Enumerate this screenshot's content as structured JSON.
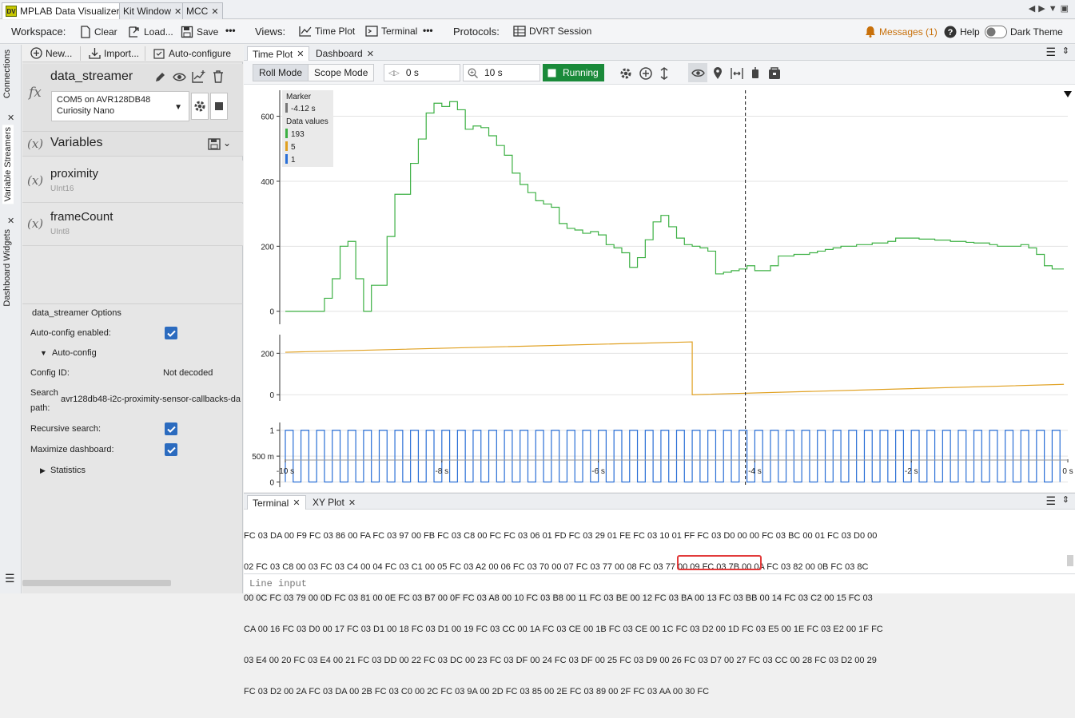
{
  "window_tabs": [
    {
      "label": "MPLAB Data Visualizer",
      "icon": "DV",
      "active": true
    },
    {
      "label": "Kit Window"
    },
    {
      "label": "MCC"
    }
  ],
  "toolbar": {
    "workspace_label": "Workspace:",
    "clear": "Clear",
    "load": "Load...",
    "save": "Save",
    "more": "•••",
    "views_label": "Views:",
    "time_plot": "Time Plot",
    "terminal": "Terminal",
    "protocols_label": "Protocols:",
    "dvrt_session": "DVRT Session",
    "messages": "Messages (1)",
    "help": "Help",
    "dark_theme": "Dark Theme"
  },
  "rail": {
    "connections": "Connections",
    "variable_streamers": "Variable Streamers",
    "dashboard_widgets": "Dashboard Widgets"
  },
  "left_panel": {
    "new": "New...",
    "import": "Import...",
    "auto_configure": "Auto-configure",
    "streamer_name": "data_streamer",
    "fx": "fx",
    "port_line1": "COM5 on AVR128DB48",
    "port_line2": "Curiosity Nano",
    "var_symbol": "(x)",
    "variables_title": "Variables",
    "variables": [
      {
        "name": "proximity",
        "type": "UInt16"
      },
      {
        "name": "frameCount",
        "type": "UInt8"
      }
    ],
    "options": {
      "title": "data_streamer Options",
      "auto_config_enabled": "Auto-config enabled:",
      "auto_config": "Auto-config",
      "config_id_label": "Config ID:",
      "config_id_value": "Not decoded",
      "search_path_label1": "Search",
      "search_path_label2": "path:",
      "search_path_value": "avr128db48-i2c-proximity-sensor-callbacks-da",
      "recursive_search": "Recursive search:",
      "maximize_dashboard": "Maximize dashboard:",
      "statistics": "Statistics"
    }
  },
  "main_tabs": [
    {
      "label": "Time Plot",
      "active": true
    },
    {
      "label": "Dashboard"
    }
  ],
  "plot_toolbar": {
    "roll_mode": "Roll Mode",
    "scope_mode": "Scope Mode",
    "offset": "0 s",
    "span": "10 s",
    "running": "Running"
  },
  "legend": {
    "marker_label": "Marker",
    "marker_value": "-4.12 s",
    "data_values_label": "Data values",
    "values": [
      {
        "value": "193",
        "color": "#3cb043"
      },
      {
        "value": "5",
        "color": "#e0a020"
      },
      {
        "value": "1",
        "color": "#2a6fd6"
      }
    ]
  },
  "chart_data": {
    "type": "line",
    "x_tick_labels": [
      "-10 s",
      "-8 s",
      "-6 s",
      "-4 s",
      "-2 s",
      "0 s"
    ],
    "xlim": [
      -10,
      0
    ],
    "marker_x": -4.12,
    "panels": [
      {
        "ylim": [
          -40,
          680
        ],
        "y_tick_labels": [
          "0",
          "200",
          "400",
          "600"
        ],
        "y_ticks": [
          0,
          200,
          400,
          600
        ],
        "series": [
          {
            "color": "#3cb043",
            "x": [
              -10.0,
              -9.5,
              -9.4,
              -9.3,
              -9.2,
              -9.1,
              -9.0,
              -8.9,
              -8.7,
              -8.6,
              -8.4,
              -8.3,
              -8.2,
              -8.1,
              -8.0,
              -7.9,
              -7.8,
              -7.7,
              -7.6,
              -7.5,
              -7.4,
              -7.3,
              -7.2,
              -7.1,
              -7.0,
              -6.9,
              -6.8,
              -6.7,
              -6.6,
              -6.5,
              -6.4,
              -6.3,
              -6.2,
              -6.1,
              -6.0,
              -5.9,
              -5.8,
              -5.7,
              -5.6,
              -5.5,
              -5.4,
              -5.3,
              -5.2,
              -5.1,
              -5.0,
              -4.9,
              -4.8,
              -4.7,
              -4.6,
              -4.5,
              -4.4,
              -4.3,
              -4.2,
              -4.1,
              -4.0,
              -3.9,
              -3.8,
              -3.7,
              -3.6,
              -3.5,
              -3.4,
              -3.3,
              -3.2,
              -3.1,
              -3.0,
              -2.9,
              -2.8,
              -2.7,
              -2.6,
              -2.5,
              -2.4,
              -2.3,
              -2.2,
              -2.1,
              -2.0,
              -1.9,
              -1.8,
              -1.7,
              -1.6,
              -1.5,
              -1.4,
              -1.3,
              -1.2,
              -1.1,
              -1.0,
              -0.9,
              -0.8,
              -0.7,
              -0.6,
              -0.5,
              -0.4,
              -0.3,
              -0.2,
              -0.1
            ],
            "y": [
              0,
              40,
              100,
              200,
              215,
              100,
              0,
              80,
              230,
              360,
              455,
              530,
              610,
              640,
              630,
              645,
              620,
              560,
              570,
              565,
              540,
              510,
              480,
              425,
              390,
              365,
              340,
              330,
              320,
              270,
              255,
              250,
              240,
              245,
              235,
              205,
              195,
              180,
              135,
              165,
              220,
              275,
              295,
              260,
              225,
              205,
              200,
              195,
              185,
              115,
              120,
              125,
              130,
              140,
              125,
              125,
              140,
              170,
              170,
              175,
              175,
              180,
              185,
              190,
              195,
              200,
              200,
              205,
              205,
              210,
              210,
              215,
              225,
              225,
              225,
              222,
              222,
              219,
              219,
              215,
              215,
              212,
              210,
              210,
              205,
              200,
              200,
              200,
              205,
              195,
              175,
              140,
              130,
              130
            ]
          }
        ]
      },
      {
        "ylim": [
          -30,
          290
        ],
        "y_tick_labels": [
          "0",
          "200"
        ],
        "y_ticks": [
          0,
          200
        ],
        "series": [
          {
            "color": "#e0a020",
            "x": [
              -10.0,
              -4.8,
              -4.8,
              -0.05
            ],
            "y": [
              205,
              255,
              0,
              50
            ]
          }
        ]
      },
      {
        "ylim": [
          -0.1,
          1.15
        ],
        "y_tick_labels": [
          "0",
          "500 m",
          "1"
        ],
        "y_ticks": [
          0,
          0.5,
          1
        ],
        "series": [
          {
            "color": "#2a6fd6",
            "type": "square_wave",
            "period_s": 0.2,
            "x_start": -10.0,
            "x_end": -0.1,
            "low": 0,
            "high": 1
          }
        ]
      }
    ]
  },
  "terminal": {
    "tabs": [
      {
        "label": "Terminal",
        "active": true
      },
      {
        "label": "XY Plot"
      }
    ],
    "lines": [
      "FC 03 DA 00 F9 FC 03 86 00 FA FC 03 97 00 FB FC 03 C8 00 FC FC 03 06 01 FD FC 03 29 01 FE FC 03 10 01 FF FC 03 D0 00 00 FC 03 BC 00 01 FC 03 D0 00",
      "02 FC 03 C8 00 03 FC 03 C4 00 04 FC 03 C1 00 05 FC 03 A2 00 06 FC 03 70 00 07 FC 03 77 00 08 FC 03 77 00 09 FC 03 7B 00 0A FC 03 82 00 0B FC 03 8C",
      "00 0C FC 03 79 00 0D FC 03 81 00 0E FC 03 B7 00 0F FC 03 A8 00 10 FC 03 B8 00 11 FC 03 BE 00 12 FC 03 BA 00 13 FC 03 BB 00 14 FC 03 C2 00 15 FC 03",
      "CA 00 16 FC 03 D0 00 17 FC 03 D1 00 18 FC 03 D1 00 19 FC 03 CC 00 1A FC 03 CE 00 1B FC 03 CE 00 1C FC 03 D2 00 1D FC 03 E5 00 1E FC 03 E2 00 1F FC",
      "03 E4 00 20 FC 03 E4 00 21 FC 03 DD 00 22 FC 03 DC 00 23 FC 03 DF 00 24 FC 03 DF 00 25 FC 03 D9 00 26 FC 03 D7 00 27 FC 03 CC 00 28 FC 03 D2 00 29",
      "FC 03 D2 00 2A FC 03 DA 00 2B FC 03 C0 00 2C FC 03 9A 00 2D FC 03 85 00 2E FC 03 89 00 2F FC 03 AA 00 30 FC"
    ],
    "line_input_placeholder": "Line input"
  }
}
